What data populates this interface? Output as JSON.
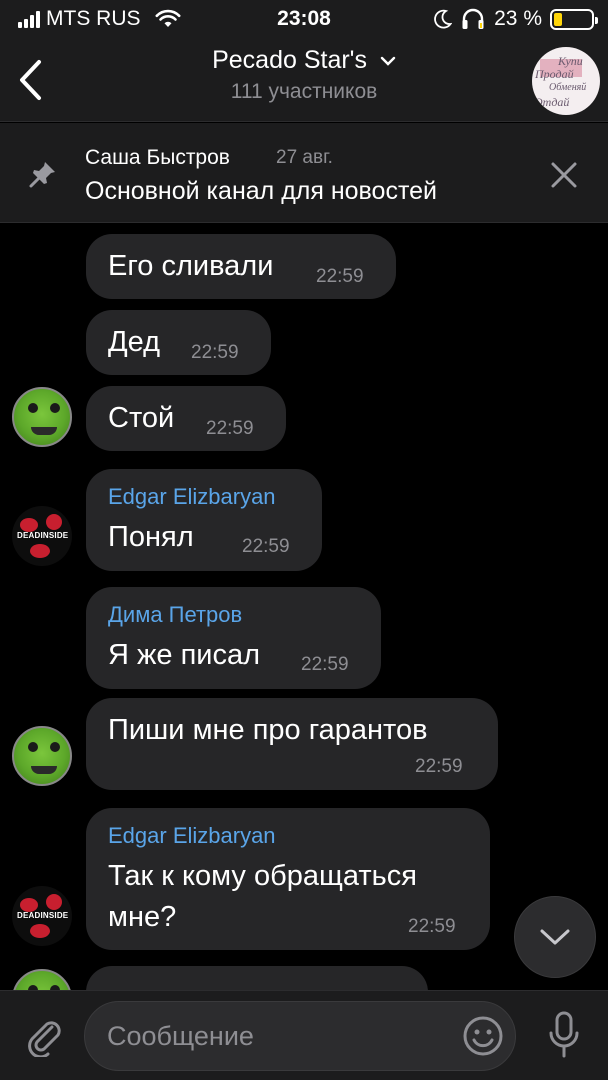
{
  "status_bar": {
    "carrier": "MTS RUS",
    "time": "23:08",
    "battery": "23 %",
    "battery_level": 0.23
  },
  "header": {
    "title": "Pecado Star's",
    "subtitle": "111 участников",
    "avatar_text": [
      "Купи",
      "Продай",
      "Обменяй",
      "Отдай"
    ]
  },
  "pinned": {
    "author": "Саша Быстров",
    "date": "27 авг.",
    "text": "Основной канал для новостей"
  },
  "messages": [
    {
      "text": "Его сливали",
      "time": "22:59"
    },
    {
      "text": "Дед",
      "time": "22:59"
    },
    {
      "text": "Стой",
      "time": "22:59"
    },
    {
      "sender": "Edgar Elizbaryan",
      "text": "Понял",
      "time": "22:59"
    },
    {
      "sender": "Дима Петров",
      "text": "Я же писал",
      "time": "22:59"
    },
    {
      "text": "Пиши мне про гарантов",
      "time": "22:59"
    },
    {
      "sender": "Edgar Elizbaryan",
      "text_line1": "Так к кому обращаться",
      "text_line2": "мне?",
      "time": "22:59"
    }
  ],
  "avatars": {
    "deadinside_label": "DEADINSIDE"
  },
  "composer": {
    "placeholder": "Сообщение"
  },
  "colors": {
    "accent": "#5aa5e9",
    "bubble": "#262628",
    "battery": "#ffd60a"
  }
}
